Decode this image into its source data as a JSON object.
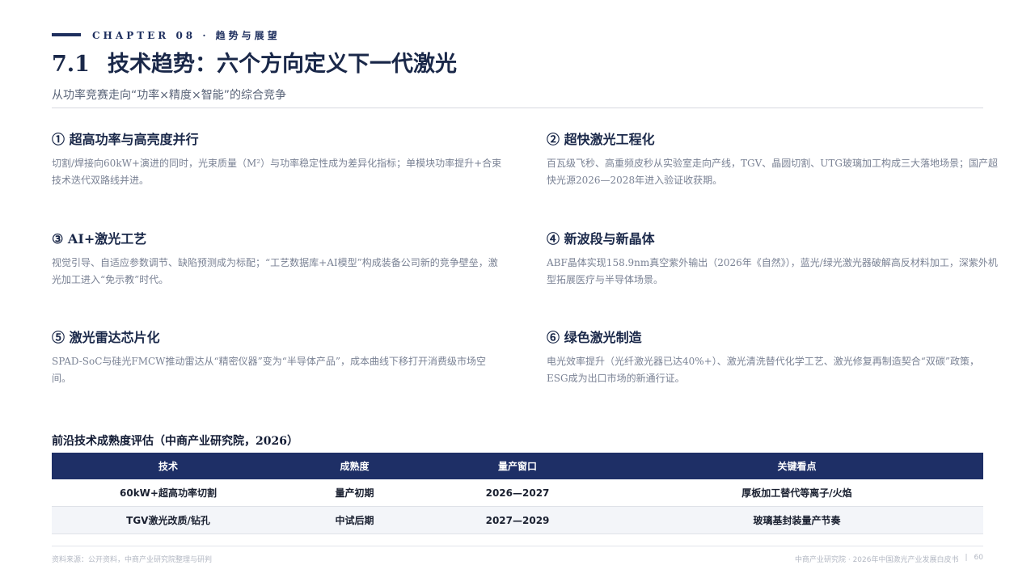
{
  "header": {
    "chapter": "CHAPTER 08 · 趋势与展望",
    "section_num": "7.1",
    "title": "技术趋势：六个方向定义下一代激光",
    "subtitle": "从功率竞赛走向“功率×精度×智能”的综合竞争"
  },
  "trends": [
    {
      "title": "① 超高功率与高亮度并行",
      "body": "切割/焊接向60kW+演进的同时，光束质量（M²）与功率稳定性成为差异化指标；单模块功率提升+合束技术迭代双路线并进。"
    },
    {
      "title": "② 超快激光工程化",
      "body": "百瓦级飞秒、高重频皮秒从实验室走向产线，TGV、晶圆切割、UTG玻璃加工构成三大落地场景；国产超快光源2026—2028年进入验证收获期。"
    },
    {
      "title": "③ AI+激光工艺",
      "body": "视觉引导、自适应参数调节、缺陷预测成为标配；“工艺数据库+AI模型”构成装备公司新的竞争壁垒，激光加工进入“免示教”时代。"
    },
    {
      "title": "④ 新波段与新晶体",
      "body": "ABF晶体实现158.9nm真空紫外输出（2026年《自然》），蓝光/绿光激光器破解高反材料加工，深紫外机型拓展医疗与半导体场景。"
    },
    {
      "title": "⑤ 激光雷达芯片化",
      "body": "SPAD-SoC与硅光FMCW推动雷达从“精密仪器”变为“半导体产品”，成本曲线下移打开消费级市场空间。"
    },
    {
      "title": "⑥ 绿色激光制造",
      "body": "电光效率提升（光纤激光器已达40%+）、激光清洗替代化学工艺、激光修复再制造契合“双碳”政策，ESG成为出口市场的新通行证。"
    }
  ],
  "table": {
    "title": "前沿技术成熟度评估（中商产业研究院，2026）",
    "headers": [
      "技术",
      "成熟度",
      "量产窗口",
      "关键看点"
    ],
    "rows": [
      [
        "60kW+超高功率切割",
        "量产初期",
        "2026—2027",
        "厚板加工替代等离子/火焰"
      ],
      [
        "TGV激光改质/钻孔",
        "中试后期",
        "2027—2029",
        "玻璃基封装量产节奏"
      ]
    ]
  },
  "footer": {
    "source": "资料来源：公开资料，中商产业研究院整理与研判",
    "publisher": "中商产业研究院 · 2026年中国激光产业发展白皮书",
    "separator": "|",
    "page": "60"
  }
}
